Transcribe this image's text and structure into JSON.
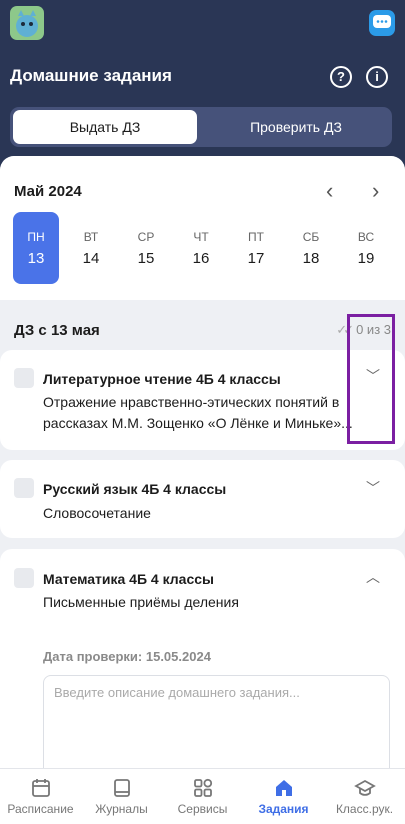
{
  "header": {
    "title": "Домашние задания",
    "help_icon": "question-icon",
    "info_icon": "info-icon"
  },
  "segments": {
    "issue": "Выдать ДЗ",
    "check": "Проверить ДЗ"
  },
  "calendar": {
    "month": "Май 2024",
    "days": [
      {
        "name": "ПН",
        "date": "13"
      },
      {
        "name": "ВТ",
        "date": "14"
      },
      {
        "name": "СР",
        "date": "15"
      },
      {
        "name": "ЧТ",
        "date": "16"
      },
      {
        "name": "ПТ",
        "date": "17"
      },
      {
        "name": "СБ",
        "date": "18"
      },
      {
        "name": "ВС",
        "date": "19"
      }
    ]
  },
  "section": {
    "title": "ДЗ с 13 мая",
    "progress": "0 из 3"
  },
  "homework": [
    {
      "subject": "Литературное чтение 4Б 4 классы",
      "description": "Отражение нравственно-этических понятий в рассказах М.М. Зощенко «О Лёнке и Миньке»..."
    },
    {
      "subject": "Русский язык 4Б 4 классы",
      "description": "Словосочетание"
    },
    {
      "subject": "Математика 4Б 4 классы",
      "description": "Письменные приёмы деления",
      "due": "Дата проверки: 15.05.2024",
      "placeholder": "Введите описание домашнего задания..."
    }
  ],
  "tabs": [
    {
      "label": "Расписание",
      "icon": "calendar-icon"
    },
    {
      "label": "Журналы",
      "icon": "book-icon"
    },
    {
      "label": "Сервисы",
      "icon": "grid-icon"
    },
    {
      "label": "Задания",
      "icon": "home-icon"
    },
    {
      "label": "Класс.рук.",
      "icon": "graduation-cap-icon"
    }
  ],
  "colors": {
    "header_bg": "#2a3655",
    "accent": "#4a73e8",
    "highlight": "#7b1fa2"
  }
}
